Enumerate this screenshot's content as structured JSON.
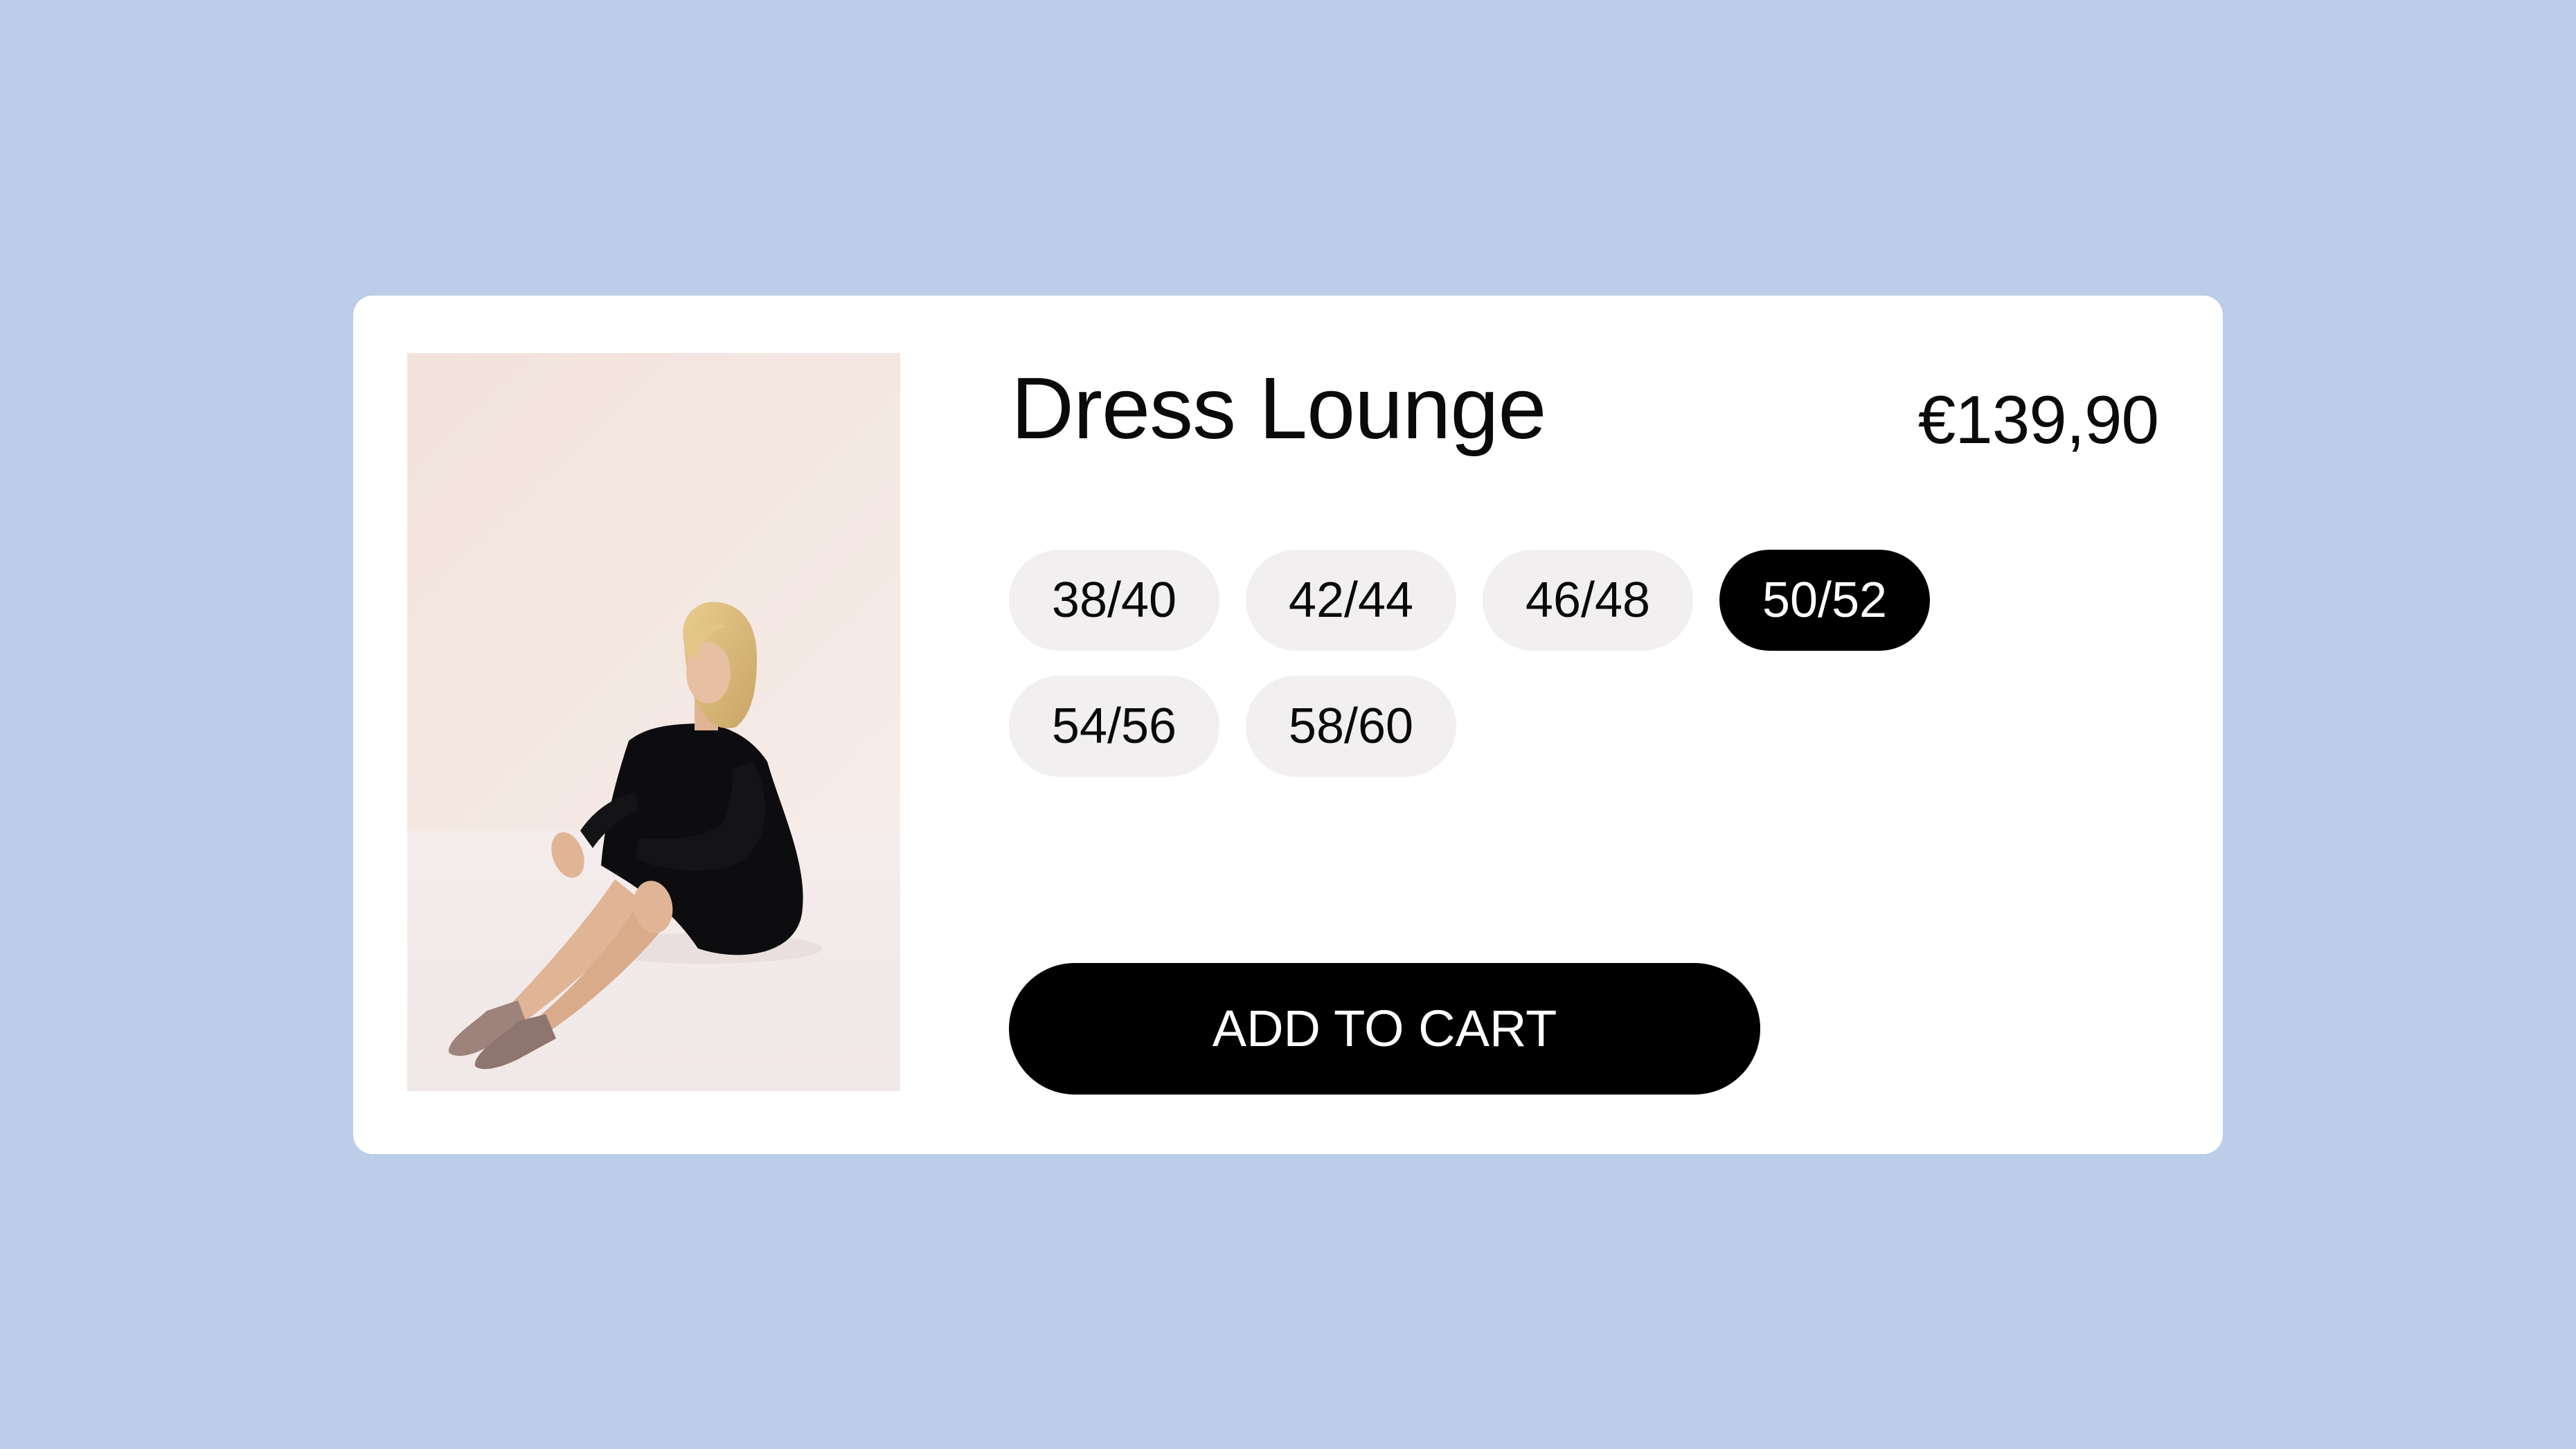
{
  "colors": {
    "page_background": "#bbcde8",
    "card_background": "#ffffff",
    "chip_background": "#f2eff1",
    "chip_text": "#0a0a0a",
    "chip_selected_background": "#000000",
    "chip_selected_text": "#ffffff",
    "button_background": "#000000",
    "button_text": "#ffffff"
  },
  "product": {
    "title": "Dress Lounge",
    "price": "€139,90",
    "image_alt": "product-photo"
  },
  "sizes": [
    {
      "label": "38/40",
      "selected": false
    },
    {
      "label": "42/44",
      "selected": false
    },
    {
      "label": "46/48",
      "selected": false
    },
    {
      "label": "50/52",
      "selected": true
    },
    {
      "label": "54/56",
      "selected": false
    },
    {
      "label": "58/60",
      "selected": false
    }
  ],
  "cart": {
    "add_label": "ADD TO CART"
  }
}
